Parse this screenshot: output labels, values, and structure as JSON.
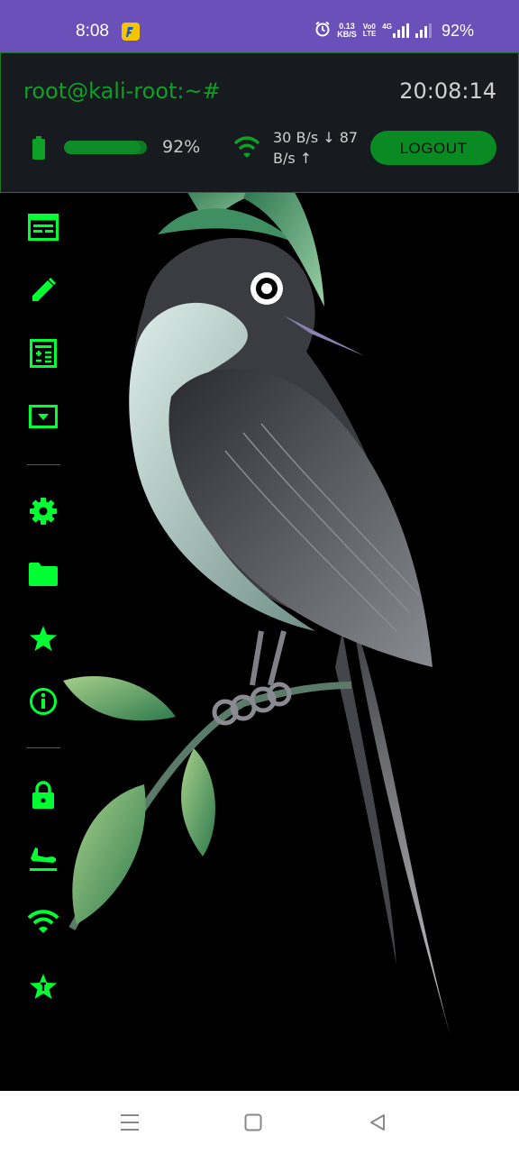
{
  "status_bar": {
    "time": "8:08",
    "net_speed_value": "0.13",
    "net_speed_unit": "KB/S",
    "volte_line1": "Vo0",
    "volte_line2": "LTE",
    "network_label": "4G",
    "battery": "92%"
  },
  "header": {
    "prompt": "root@kali-root:~#",
    "clock": "20:08:14",
    "battery_percent_text": "92%",
    "battery_level": 0.92,
    "network_text": "30 B/s ↓ 87 B/s ↑",
    "logout_label": "LOGOUT"
  },
  "sidebar": {
    "items": [
      {
        "icon": "terminal-icon"
      },
      {
        "icon": "pencil-icon"
      },
      {
        "icon": "calculator-icon"
      },
      {
        "icon": "dropdown-box-icon"
      },
      {
        "icon": "gear-icon"
      },
      {
        "icon": "folder-icon"
      },
      {
        "icon": "star-icon"
      },
      {
        "icon": "info-icon"
      },
      {
        "icon": "lock-icon"
      },
      {
        "icon": "airplane-landing-icon"
      },
      {
        "icon": "wifi-icon"
      },
      {
        "icon": "star-badge-icon"
      }
    ]
  },
  "colors": {
    "accent": "#00ff33",
    "status_bar": "#6a50b8",
    "header_bg": "#171a1e",
    "logout_bg": "#098a22"
  }
}
